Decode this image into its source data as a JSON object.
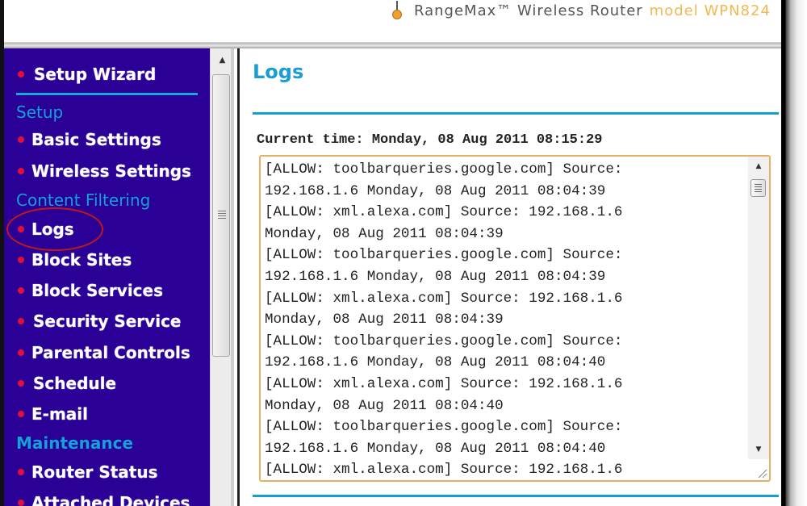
{
  "header": {
    "brand_name": "RangeMax™ Wireless Router",
    "brand_model": "model WPN824"
  },
  "sidebar": {
    "setup_wizard": "Setup Wizard",
    "sections": {
      "setup": "Setup",
      "content_filtering": "Content Filtering",
      "maintenance": "Maintenance"
    },
    "items": [
      {
        "label": "Basic Settings"
      },
      {
        "label": "Wireless Settings"
      },
      {
        "label": "Logs"
      },
      {
        "label": "Block Sites"
      },
      {
        "label": "Block Services"
      },
      {
        "label": "Security Service"
      },
      {
        "label": "Parental Controls"
      },
      {
        "label": "Schedule"
      },
      {
        "label": "E-mail"
      },
      {
        "label": "Router Status"
      },
      {
        "label": "Attached Devices"
      }
    ],
    "highlighted_item": "Logs"
  },
  "main": {
    "title": "Logs",
    "current_time_label": "Current time: Monday, 08 Aug 2011 08:15:29",
    "log_lines": [
      "[ALLOW: toolbarqueries.google.com] Source:",
      "192.168.1.6 Monday, 08 Aug 2011 08:04:39",
      "[ALLOW: xml.alexa.com] Source: 192.168.1.6",
      "Monday, 08 Aug 2011 08:04:39",
      "[ALLOW: toolbarqueries.google.com] Source:",
      "192.168.1.6 Monday, 08 Aug 2011 08:04:39",
      "[ALLOW: xml.alexa.com] Source: 192.168.1.6",
      "Monday, 08 Aug 2011 08:04:39",
      "[ALLOW: toolbarqueries.google.com] Source:",
      "192.168.1.6 Monday, 08 Aug 2011 08:04:40",
      "[ALLOW: xml.alexa.com] Source: 192.168.1.6",
      "Monday, 08 Aug 2011 08:04:40",
      "[ALLOW: toolbarqueries.google.com] Source:",
      "192.168.1.6 Monday, 08 Aug 2011 08:04:40",
      "[ALLOW: xml.alexa.com] Source: 192.168.1.6"
    ]
  },
  "colors": {
    "sidebar_bg": "#2a0096",
    "accent_blue": "#1a9cd8",
    "bullet_red": "#e0103a",
    "brand_orange": "#f4b850",
    "log_border": "#e8b060"
  }
}
